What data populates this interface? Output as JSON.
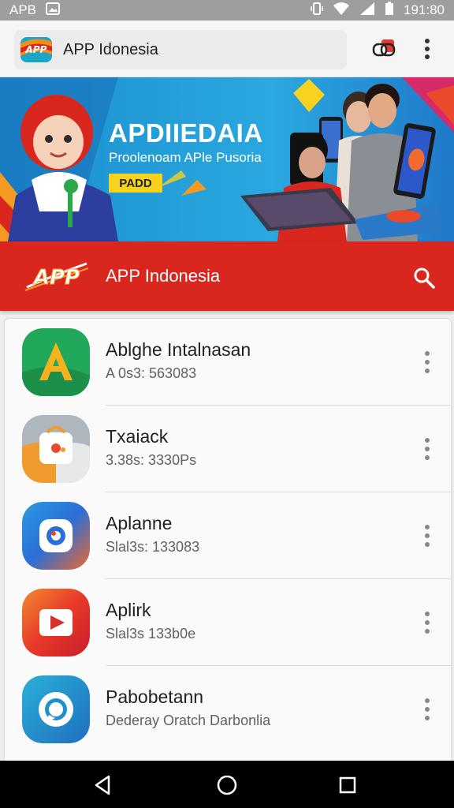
{
  "status_bar": {
    "carrier": "APB",
    "time": "191:80"
  },
  "top_bar": {
    "title": "APP Idonesia"
  },
  "banner": {
    "title": "APDIIEDAIA",
    "subtitle": "Proolenoam APle Pusoria",
    "badge": "PADD"
  },
  "header": {
    "logo_text": "APP",
    "title": "APP Indonesia"
  },
  "apps": [
    {
      "name": "Ablghe Intalnasan",
      "detail": "A 0s3: 563083",
      "icon": "green-a-icon",
      "color": "#22a85a"
    },
    {
      "name": "Txaiack",
      "detail": "3.38s: 3330Ps",
      "icon": "orange-bag-icon",
      "color": "#f19a2e"
    },
    {
      "name": "Aplanne",
      "detail": "Slal3s: 133083",
      "icon": "camera-icon",
      "color": "#2b6fd6"
    },
    {
      "name": "Aplirk",
      "detail": "Slal3s 133b0e",
      "icon": "play-icon",
      "color": "#d6322a"
    },
    {
      "name": "Pabobetann",
      "detail": "Dederay Oratch Darbonlia",
      "icon": "chat-bubble-icon",
      "color": "#1f8fd0"
    }
  ]
}
